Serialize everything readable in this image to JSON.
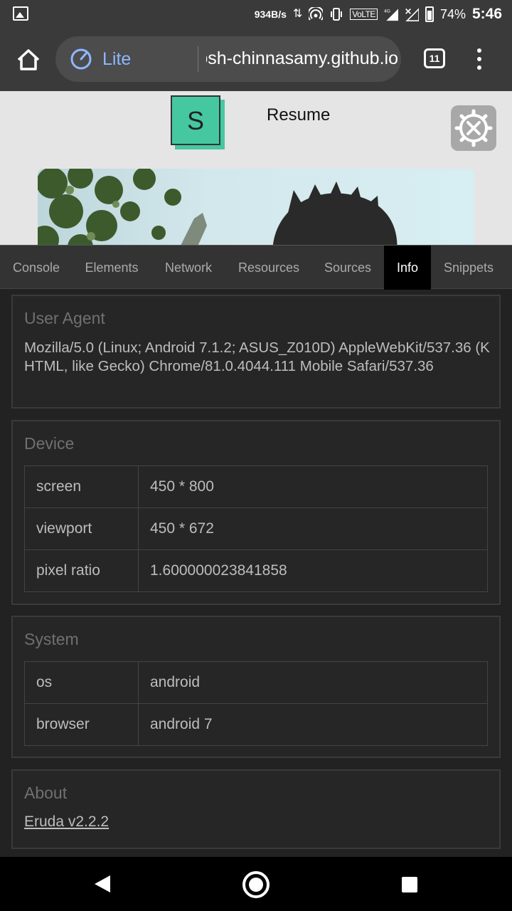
{
  "status_bar": {
    "net_speed": "934B/s",
    "volte": "VoLTE",
    "network_type": "4G",
    "battery": "74%",
    "time": "5:46"
  },
  "browser": {
    "lite_label": "Lite",
    "url": "santhosh-chinnasamy.github.io",
    "tab_count": "11"
  },
  "page": {
    "logo_letter": "S",
    "title": "Resume"
  },
  "devtools": {
    "tabs": [
      "Console",
      "Elements",
      "Network",
      "Resources",
      "Sources",
      "Info",
      "Snippets"
    ],
    "active_tab": "Info",
    "user_agent": {
      "title": "User Agent",
      "value": "Mozilla/5.0 (Linux; Android 7.1.2; ASUS_Z010D) AppleWebKit/537.36 (KHTML, like Gecko) Chrome/81.0.4044.111 Mobile Safari/537.36"
    },
    "device": {
      "title": "Device",
      "rows": [
        {
          "key": "screen",
          "value": "450 * 800"
        },
        {
          "key": "viewport",
          "value": "450 * 672"
        },
        {
          "key": "pixel ratio",
          "value": "1.600000023841858"
        }
      ]
    },
    "system": {
      "title": "System",
      "rows": [
        {
          "key": "os",
          "value": "android"
        },
        {
          "key": "browser",
          "value": "android 7"
        }
      ]
    },
    "about": {
      "title": "About",
      "link": "Eruda v2.2.2"
    }
  }
}
